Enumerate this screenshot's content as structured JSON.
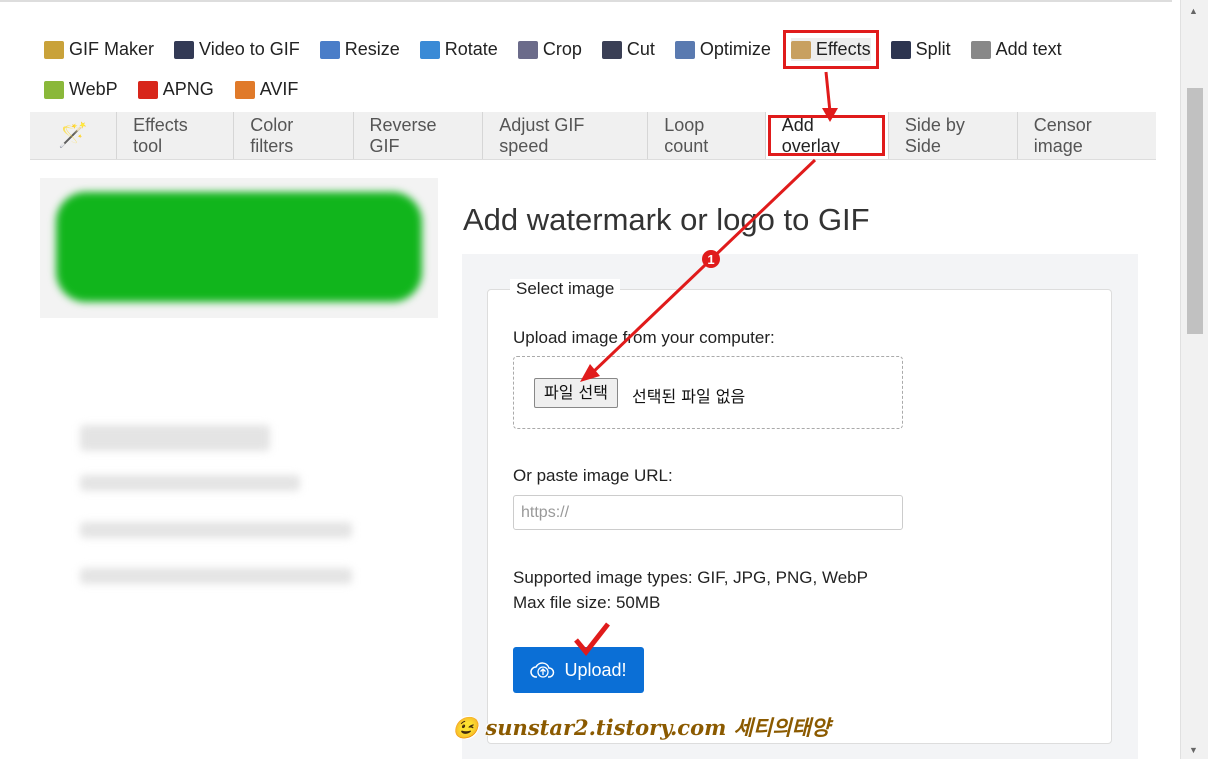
{
  "nav": {
    "items": [
      {
        "label": "GIF Maker",
        "icon": "gif-maker-icon",
        "color": "#c9a23a"
      },
      {
        "label": "Video to GIF",
        "icon": "film-icon",
        "color": "#333a55"
      },
      {
        "label": "Resize",
        "icon": "resize-icon",
        "color": "#4a7dc8"
      },
      {
        "label": "Rotate",
        "icon": "rotate-icon",
        "color": "#3a8ad6"
      },
      {
        "label": "Crop",
        "icon": "crop-icon",
        "color": "#6b6b8a"
      },
      {
        "label": "Cut",
        "icon": "cut-icon",
        "color": "#3a3f55"
      },
      {
        "label": "Optimize",
        "icon": "optimize-icon",
        "color": "#5a7ab0"
      },
      {
        "label": "Effects",
        "icon": "effects-palette-icon",
        "color": "#c8a060",
        "highlighted": true
      },
      {
        "label": "Split",
        "icon": "split-icon",
        "color": "#2d3550"
      },
      {
        "label": "Add text",
        "icon": "add-text-icon",
        "color": "#888"
      },
      {
        "label": "WebP",
        "icon": "webp-icon",
        "color": "#8ab83a"
      },
      {
        "label": "APNG",
        "icon": "apng-icon",
        "color": "#d8261b"
      },
      {
        "label": "AVIF",
        "icon": "avif-icon",
        "color": "#e07a2a"
      }
    ]
  },
  "subnav": {
    "tabs": [
      {
        "label": "Effects tool"
      },
      {
        "label": "Color filters"
      },
      {
        "label": "Reverse GIF"
      },
      {
        "label": "Adjust GIF speed"
      },
      {
        "label": "Loop count"
      },
      {
        "label": "Add overlay",
        "active": true
      },
      {
        "label": "Side by Side"
      },
      {
        "label": "Censor image"
      }
    ]
  },
  "main": {
    "title": "Add watermark or logo to GIF",
    "legend": "Select image",
    "upload_label": "Upload image from your computer:",
    "file_button": "파일 선택",
    "no_file": "선택된 파일 없음",
    "url_label": "Or paste image URL:",
    "url_placeholder": "https://",
    "supported": "Supported image types: GIF, JPG, PNG, WebP",
    "max_size": "Max file size: 50MB",
    "upload_button": "Upload!"
  },
  "annotation": {
    "step": "1",
    "color": "#e01b1b"
  },
  "watermark": "sunstar2.tistory.com 세티의태양"
}
